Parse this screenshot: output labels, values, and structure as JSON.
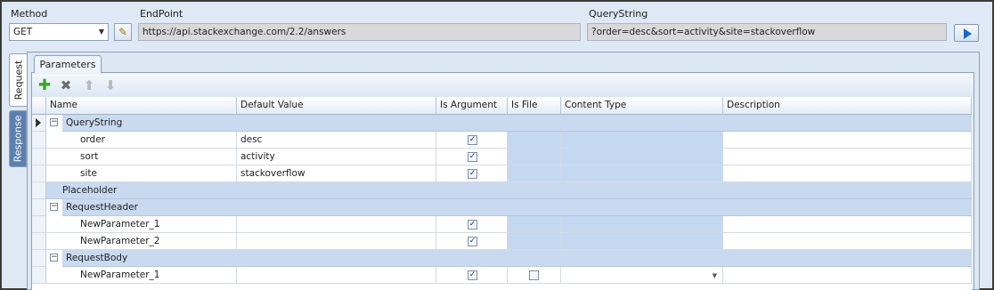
{
  "labels": {
    "method": "Method",
    "endpoint": "EndPoint",
    "querystring": "QueryString"
  },
  "method": {
    "value": "GET"
  },
  "endpoint": {
    "value": "https://api.stackexchange.com/2.2/answers"
  },
  "querystring": {
    "value": "?order=desc&sort=activity&site=stackoverflow"
  },
  "side_tabs": {
    "request": "Request",
    "response": "Response"
  },
  "panel_tab": "Parameters",
  "toolbar": {
    "add": "add-icon",
    "delete": "delete-icon",
    "up": "arrow-up-icon",
    "down": "arrow-down-icon"
  },
  "columns": [
    "Name",
    "Default Value",
    "Is Argument",
    "Is File",
    "Content Type",
    "Description"
  ],
  "groups": {
    "querystring": "QueryString",
    "placeholder": "Placeholder",
    "requestheader": "RequestHeader",
    "requestbody": "RequestBody"
  },
  "rows": {
    "qs": [
      {
        "name": "order",
        "default": "desc",
        "is_argument": true
      },
      {
        "name": "sort",
        "default": "activity",
        "is_argument": true
      },
      {
        "name": "site",
        "default": "stackoverflow",
        "is_argument": true
      }
    ],
    "header": [
      {
        "name": "NewParameter_1",
        "default": "",
        "is_argument": true
      },
      {
        "name": "NewParameter_2",
        "default": "",
        "is_argument": true
      }
    ],
    "body": [
      {
        "name": "NewParameter_1",
        "default": "",
        "is_argument": true,
        "is_file": false
      }
    ]
  },
  "colors": {
    "accent": "#1a66d0",
    "group_band": "#c9daf0",
    "panel": "#dce7f4"
  }
}
